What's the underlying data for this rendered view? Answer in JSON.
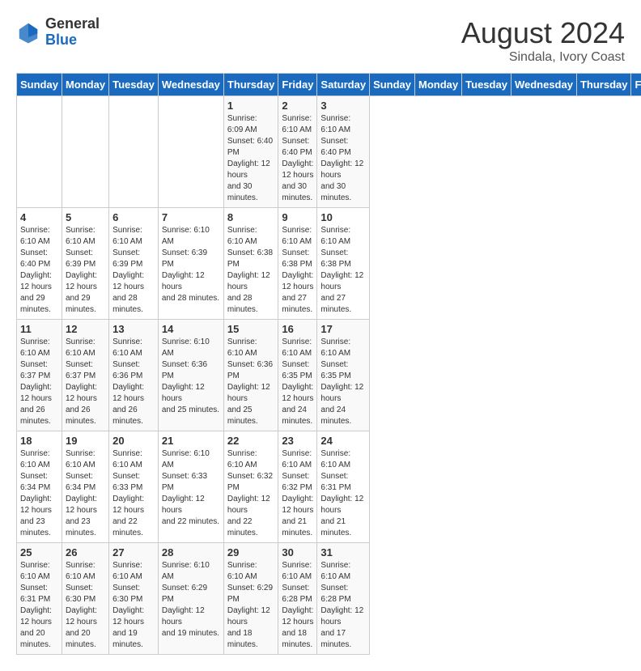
{
  "header": {
    "logo_general": "General",
    "logo_blue": "Blue",
    "month_title": "August 2024",
    "subtitle": "Sindala, Ivory Coast"
  },
  "days_of_week": [
    "Sunday",
    "Monday",
    "Tuesday",
    "Wednesday",
    "Thursday",
    "Friday",
    "Saturday"
  ],
  "weeks": [
    [
      {
        "day": "",
        "info": ""
      },
      {
        "day": "",
        "info": ""
      },
      {
        "day": "",
        "info": ""
      },
      {
        "day": "",
        "info": ""
      },
      {
        "day": "1",
        "info": "Sunrise: 6:09 AM\nSunset: 6:40 PM\nDaylight: 12 hours\nand 30 minutes."
      },
      {
        "day": "2",
        "info": "Sunrise: 6:10 AM\nSunset: 6:40 PM\nDaylight: 12 hours\nand 30 minutes."
      },
      {
        "day": "3",
        "info": "Sunrise: 6:10 AM\nSunset: 6:40 PM\nDaylight: 12 hours\nand 30 minutes."
      }
    ],
    [
      {
        "day": "4",
        "info": "Sunrise: 6:10 AM\nSunset: 6:40 PM\nDaylight: 12 hours\nand 29 minutes."
      },
      {
        "day": "5",
        "info": "Sunrise: 6:10 AM\nSunset: 6:39 PM\nDaylight: 12 hours\nand 29 minutes."
      },
      {
        "day": "6",
        "info": "Sunrise: 6:10 AM\nSunset: 6:39 PM\nDaylight: 12 hours\nand 28 minutes."
      },
      {
        "day": "7",
        "info": "Sunrise: 6:10 AM\nSunset: 6:39 PM\nDaylight: 12 hours\nand 28 minutes."
      },
      {
        "day": "8",
        "info": "Sunrise: 6:10 AM\nSunset: 6:38 PM\nDaylight: 12 hours\nand 28 minutes."
      },
      {
        "day": "9",
        "info": "Sunrise: 6:10 AM\nSunset: 6:38 PM\nDaylight: 12 hours\nand 27 minutes."
      },
      {
        "day": "10",
        "info": "Sunrise: 6:10 AM\nSunset: 6:38 PM\nDaylight: 12 hours\nand 27 minutes."
      }
    ],
    [
      {
        "day": "11",
        "info": "Sunrise: 6:10 AM\nSunset: 6:37 PM\nDaylight: 12 hours\nand 26 minutes."
      },
      {
        "day": "12",
        "info": "Sunrise: 6:10 AM\nSunset: 6:37 PM\nDaylight: 12 hours\nand 26 minutes."
      },
      {
        "day": "13",
        "info": "Sunrise: 6:10 AM\nSunset: 6:36 PM\nDaylight: 12 hours\nand 26 minutes."
      },
      {
        "day": "14",
        "info": "Sunrise: 6:10 AM\nSunset: 6:36 PM\nDaylight: 12 hours\nand 25 minutes."
      },
      {
        "day": "15",
        "info": "Sunrise: 6:10 AM\nSunset: 6:36 PM\nDaylight: 12 hours\nand 25 minutes."
      },
      {
        "day": "16",
        "info": "Sunrise: 6:10 AM\nSunset: 6:35 PM\nDaylight: 12 hours\nand 24 minutes."
      },
      {
        "day": "17",
        "info": "Sunrise: 6:10 AM\nSunset: 6:35 PM\nDaylight: 12 hours\nand 24 minutes."
      }
    ],
    [
      {
        "day": "18",
        "info": "Sunrise: 6:10 AM\nSunset: 6:34 PM\nDaylight: 12 hours\nand 23 minutes."
      },
      {
        "day": "19",
        "info": "Sunrise: 6:10 AM\nSunset: 6:34 PM\nDaylight: 12 hours\nand 23 minutes."
      },
      {
        "day": "20",
        "info": "Sunrise: 6:10 AM\nSunset: 6:33 PM\nDaylight: 12 hours\nand 22 minutes."
      },
      {
        "day": "21",
        "info": "Sunrise: 6:10 AM\nSunset: 6:33 PM\nDaylight: 12 hours\nand 22 minutes."
      },
      {
        "day": "22",
        "info": "Sunrise: 6:10 AM\nSunset: 6:32 PM\nDaylight: 12 hours\nand 22 minutes."
      },
      {
        "day": "23",
        "info": "Sunrise: 6:10 AM\nSunset: 6:32 PM\nDaylight: 12 hours\nand 21 minutes."
      },
      {
        "day": "24",
        "info": "Sunrise: 6:10 AM\nSunset: 6:31 PM\nDaylight: 12 hours\nand 21 minutes."
      }
    ],
    [
      {
        "day": "25",
        "info": "Sunrise: 6:10 AM\nSunset: 6:31 PM\nDaylight: 12 hours\nand 20 minutes."
      },
      {
        "day": "26",
        "info": "Sunrise: 6:10 AM\nSunset: 6:30 PM\nDaylight: 12 hours\nand 20 minutes."
      },
      {
        "day": "27",
        "info": "Sunrise: 6:10 AM\nSunset: 6:30 PM\nDaylight: 12 hours\nand 19 minutes."
      },
      {
        "day": "28",
        "info": "Sunrise: 6:10 AM\nSunset: 6:29 PM\nDaylight: 12 hours\nand 19 minutes."
      },
      {
        "day": "29",
        "info": "Sunrise: 6:10 AM\nSunset: 6:29 PM\nDaylight: 12 hours\nand 18 minutes."
      },
      {
        "day": "30",
        "info": "Sunrise: 6:10 AM\nSunset: 6:28 PM\nDaylight: 12 hours\nand 18 minutes."
      },
      {
        "day": "31",
        "info": "Sunrise: 6:10 AM\nSunset: 6:28 PM\nDaylight: 12 hours\nand 17 minutes."
      }
    ]
  ]
}
